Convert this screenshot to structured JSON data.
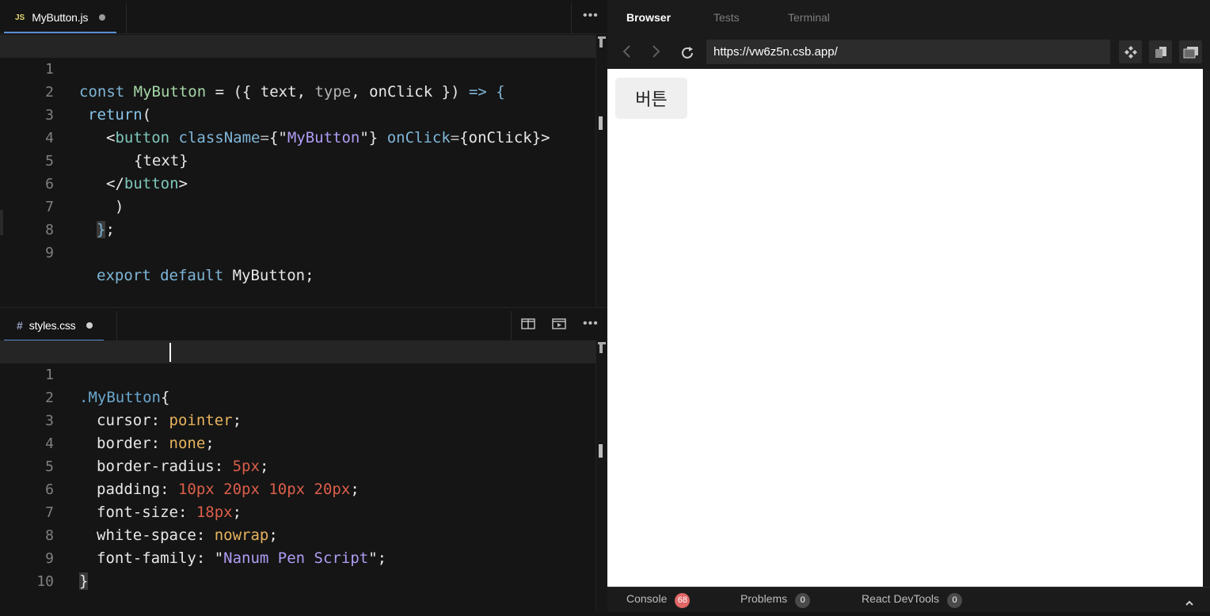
{
  "editor_top": {
    "tab": {
      "lang": "JS",
      "name": "MyButton.js"
    },
    "menu_icon": "more-horizontal-icon",
    "lines": [
      {
        "n": "1"
      },
      {
        "n": "2"
      },
      {
        "n": "3"
      },
      {
        "n": "4"
      },
      {
        "n": "5"
      },
      {
        "n": "6"
      },
      {
        "n": "7"
      },
      {
        "n": "8"
      },
      {
        "n": "9"
      }
    ]
  },
  "editor_bottom": {
    "tab": {
      "lang": "#",
      "name": "styles.css"
    },
    "icons": [
      "split-editor-icon",
      "open-preview-icon",
      "more-horizontal-icon"
    ],
    "lines": [
      {
        "n": "1"
      },
      {
        "n": "2"
      },
      {
        "n": "3"
      },
      {
        "n": "4"
      },
      {
        "n": "5"
      },
      {
        "n": "6"
      },
      {
        "n": "7"
      },
      {
        "n": "8"
      },
      {
        "n": "9"
      },
      {
        "n": "10"
      }
    ]
  },
  "code_js": {
    "l1": {
      "a": "const ",
      "b": "MyButton",
      "c": " = ({ ",
      "d": "text",
      "e": ", ",
      "f": "type",
      "g": ", ",
      "h": "onClick",
      "i": " }) ",
      "j": "=>",
      "k": " {"
    },
    "l2": {
      "a": "return",
      "b": "("
    },
    "l3": {
      "a": "<",
      "b": "button",
      "c": " ",
      "d": "className",
      "e": "=",
      "f": "{\"",
      "g": "MyButton",
      "h": "\"}",
      "i": " ",
      "j": "onClick",
      "k": "=",
      "l": "{onClick}>"
    },
    "l4": {
      "a": "{text}"
    },
    "l5": {
      "a": "</",
      "b": "button",
      "c": ">"
    },
    "l6": {
      "a": ")"
    },
    "l7": {
      "a": "}",
      "b": ";"
    },
    "l9": {
      "a": "export",
      "b": " ",
      "c": "default",
      "d": " MyButton;"
    }
  },
  "code_css": {
    "l1": {
      "a": ".MyButton",
      "b": "{"
    },
    "l2": {
      "a": "cursor",
      "b": ": ",
      "c": "pointer",
      "d": ";"
    },
    "l3": {
      "a": "border",
      "b": ": ",
      "c": "none",
      "d": ";"
    },
    "l4": {
      "a": "border-radius",
      "b": ": ",
      "c": "5px",
      "d": ";"
    },
    "l5": {
      "a": "padding",
      "b": ": ",
      "c": "10px 20px 10px 20px",
      "d": ";"
    },
    "l6": {
      "a": "font-size",
      "b": ": ",
      "c": "18px",
      "d": ";"
    },
    "l7": {
      "a": "white-space",
      "b": ": ",
      "c": "nowrap",
      "d": ";"
    },
    "l8": {
      "a": "font-family",
      "b": ": \"",
      "c": "Nanum Pen Script",
      "d": "\";"
    },
    "l9": {
      "a": "}"
    }
  },
  "browser": {
    "tabs": [
      "Browser",
      "Tests",
      "Terminal"
    ],
    "url": "https://vw6z5n.csb.app/",
    "nav_icons": [
      "back-arrow-icon",
      "forward-arrow-icon",
      "refresh-icon"
    ],
    "action_icons": [
      "codesandbox-icon",
      "open-new-window-icon",
      "open-in-new-tab-icon"
    ],
    "preview_button": "버튼"
  },
  "bottom_panel": {
    "console": {
      "label": "Console",
      "count": "68"
    },
    "problems": {
      "label": "Problems",
      "count": "0"
    },
    "devtools": {
      "label": "React DevTools",
      "count": "0"
    },
    "collapse_icon": "chevron-up-icon"
  },
  "colors": {
    "accent": "#5a8ed4",
    "error_badge": "#e06666",
    "js_label": "#e5d86f"
  }
}
